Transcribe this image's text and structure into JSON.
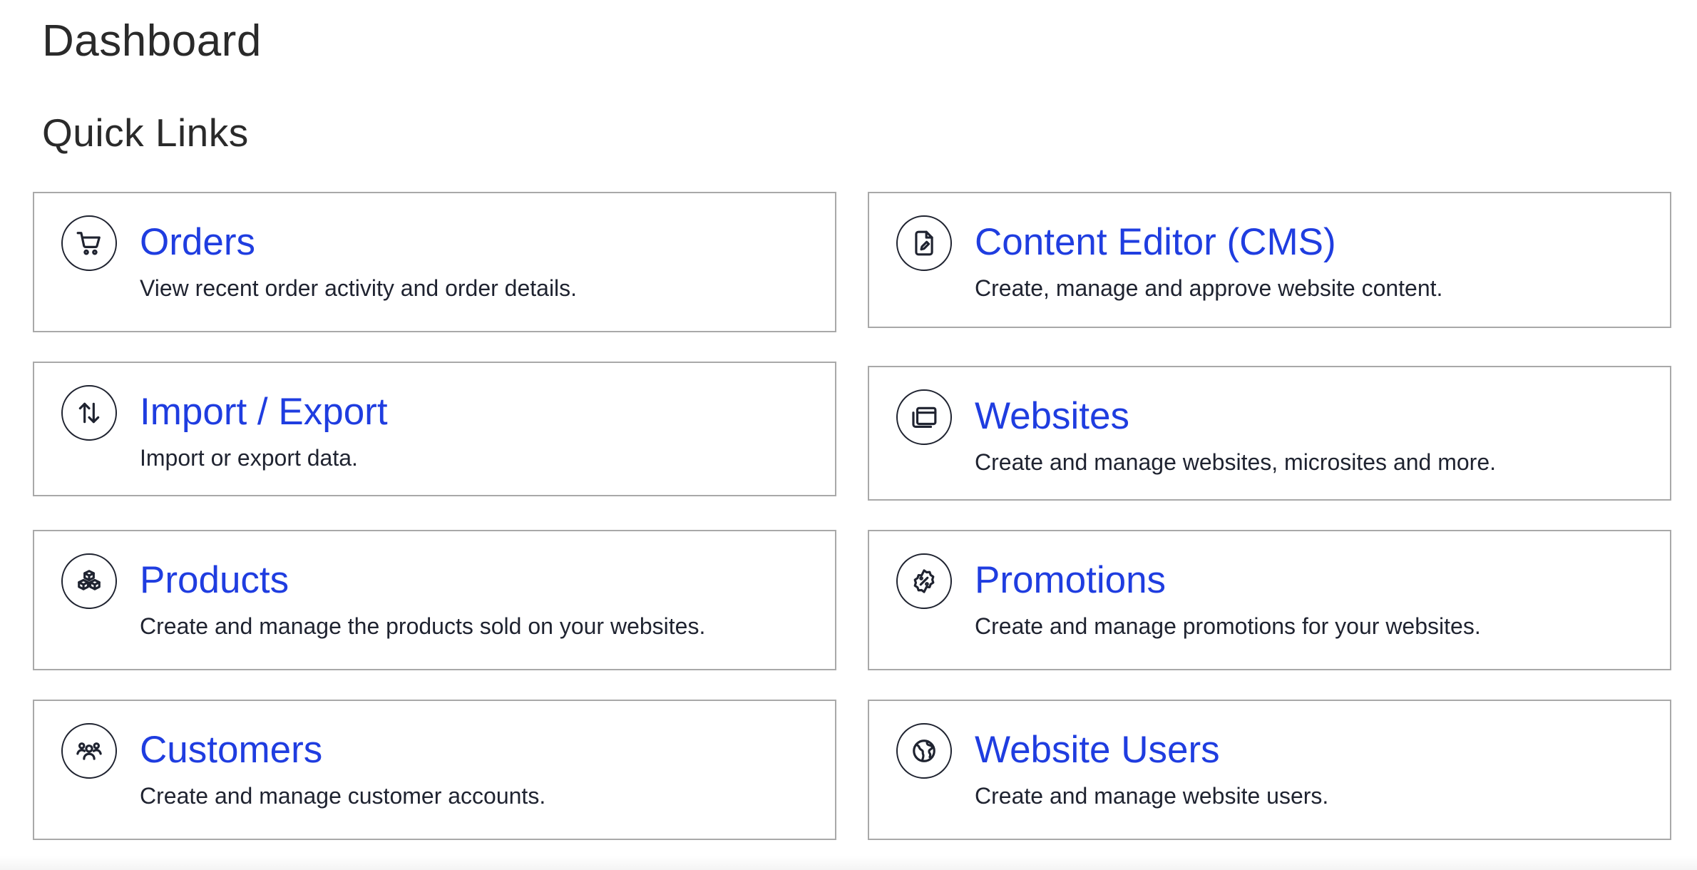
{
  "page": {
    "title": "Dashboard",
    "section_title": "Quick Links"
  },
  "colors": {
    "link": "#1f3de0",
    "text": "#1f2330",
    "border": "#a9a9a9"
  },
  "quick_links": [
    {
      "title": "Orders",
      "description": "View recent order activity and order details.",
      "icon": "cart-icon"
    },
    {
      "title": "Content Editor (CMS)",
      "description": "Create, manage and approve website content.",
      "icon": "document-edit-icon"
    },
    {
      "title": "Import / Export",
      "description": "Import or export data.",
      "icon": "up-down-arrows-icon"
    },
    {
      "title": "Websites",
      "description": "Create and manage websites, microsites and more.",
      "icon": "browser-windows-icon"
    },
    {
      "title": "Products",
      "description": "Create and manage the products sold on your websites.",
      "icon": "boxes-icon"
    },
    {
      "title": "Promotions",
      "description": "Create and manage promotions for your websites.",
      "icon": "discount-badge-icon"
    },
    {
      "title": "Customers",
      "description": "Create and manage customer accounts.",
      "icon": "people-group-icon"
    },
    {
      "title": "Website Users",
      "description": "Create and manage website users.",
      "icon": "globe-icon"
    }
  ]
}
